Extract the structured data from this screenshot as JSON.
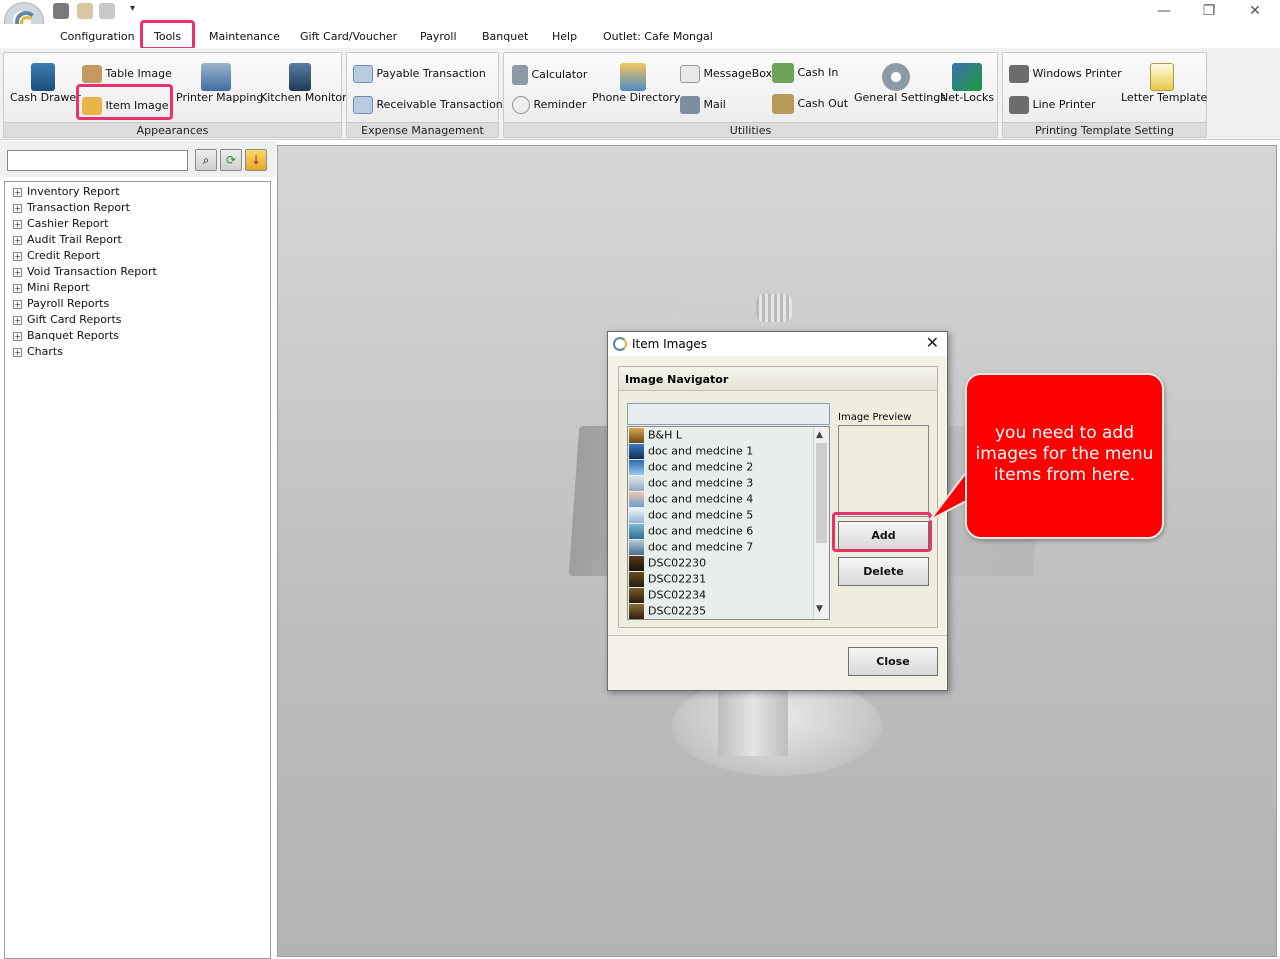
{
  "menu": [
    "Configuration",
    "Tools",
    "Maintenance",
    "Gift Card/Voucher",
    "Payroll",
    "Banquet",
    "Help",
    "Outlet: Cafe Mongal"
  ],
  "ribbon": {
    "appearances": {
      "label": "Appearances",
      "table_image": "Table Image",
      "cash_drawer": "Cash Drawer",
      "item_image": "Item Image",
      "printer_mapping": "Printer Mapping",
      "kitchen_monitor": "Kitchen Monitor"
    },
    "expense": {
      "label": "Expense Management",
      "payable": "Payable Transaction",
      "receivable": "Receivable Transaction"
    },
    "utilities": {
      "label": "Utilities",
      "calculator": "Calculator",
      "reminder": "Reminder",
      "phone_directory": "Phone Directory",
      "messagebox": "MessageBox",
      "mail": "Mail",
      "cash_in": "Cash In",
      "cash_out": "Cash Out",
      "general_settings": "General Settings",
      "net_locks": "Net-Locks"
    },
    "printing": {
      "label": "Printing Template Setting",
      "windows_printer": "Windows Printer",
      "line_printer": "Line Printer",
      "letter_template": "Letter Template"
    }
  },
  "tree": [
    "Inventory Report",
    "Transaction Report",
    "Cashier Report",
    "Audit Trail Report",
    "Credit Report",
    "Void Transaction Report",
    "Mini Report",
    "Payroll Reports",
    "Gift Card Reports",
    "Banquet Reports",
    "Charts"
  ],
  "dialog": {
    "title": "Item Images",
    "navigator_header": "Image Navigator",
    "preview_label": "Image Preview",
    "images": [
      "B&H L",
      "doc and medcine 1",
      "doc and medcine 2",
      "doc and medcine 3",
      "doc and medcine 4",
      "doc and medcine 5",
      "doc and medcine 6",
      "doc and medcine 7",
      "DSC02230",
      "DSC02231",
      "DSC02234",
      "DSC02235"
    ],
    "add": "Add",
    "delete": "Delete",
    "close": "Close"
  },
  "callout": "you need to add images for the menu items from here."
}
